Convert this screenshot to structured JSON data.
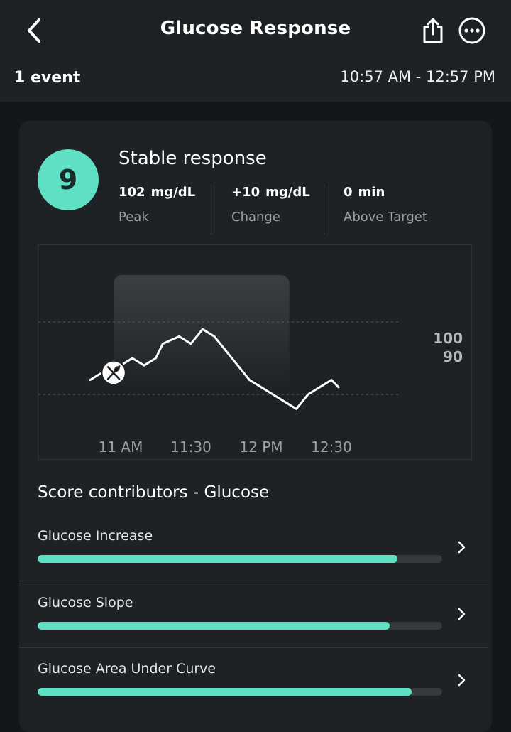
{
  "header": {
    "title": "Glucose Response",
    "event_count": "1 event",
    "time_range": "10:57 AM - 12:57 PM"
  },
  "summary": {
    "score": "9",
    "response_title": "Stable response",
    "stats": [
      {
        "value": "102",
        "unit": "mg/dL",
        "label": "Peak"
      },
      {
        "value": "+10",
        "unit": "mg/dL",
        "label": "Change"
      },
      {
        "value": "0",
        "unit": "min",
        "label": "Above Target"
      }
    ]
  },
  "chart_data": {
    "type": "line",
    "x": [
      "10:47",
      "10:52",
      "10:57",
      "11:00",
      "11:05",
      "11:10",
      "11:15",
      "11:18",
      "11:25",
      "11:30",
      "11:35",
      "11:40",
      "11:45",
      "11:50",
      "11:55",
      "12:00",
      "12:05",
      "12:10",
      "12:15",
      "12:20",
      "12:25",
      "12:30",
      "12:33"
    ],
    "y": [
      92,
      93,
      93,
      94,
      95,
      94,
      95,
      97,
      98,
      97,
      99,
      98,
      96,
      94,
      92,
      91,
      90,
      89,
      88,
      90,
      91,
      92,
      91
    ],
    "xticks": [
      "11 AM",
      "11:30",
      "12 PM",
      "12:30"
    ],
    "yticks": [
      "100",
      "90"
    ],
    "reference_lines": [
      100,
      90
    ],
    "event_marker": {
      "time": "10:57",
      "icon": "fork-knife-icon"
    },
    "shaded_window": [
      "10:57",
      "12:12"
    ],
    "ylim": [
      80,
      110
    ],
    "line_color": "#ffffff",
    "shade_color": "#3a3f42"
  },
  "contributors": {
    "title": "Score contributors - Glucose",
    "items": [
      {
        "label": "Glucose Increase",
        "fill": 0.89
      },
      {
        "label": "Glucose Slope",
        "fill": 0.87
      },
      {
        "label": "Glucose Area Under Curve",
        "fill": 0.925
      }
    ],
    "bar_color": "#5fe0c4"
  },
  "icons": {
    "back": "chevron-left-icon",
    "share": "share-icon",
    "more": "more-icon",
    "chevron": "chevron-right-icon",
    "meal": "fork-knife-icon"
  }
}
